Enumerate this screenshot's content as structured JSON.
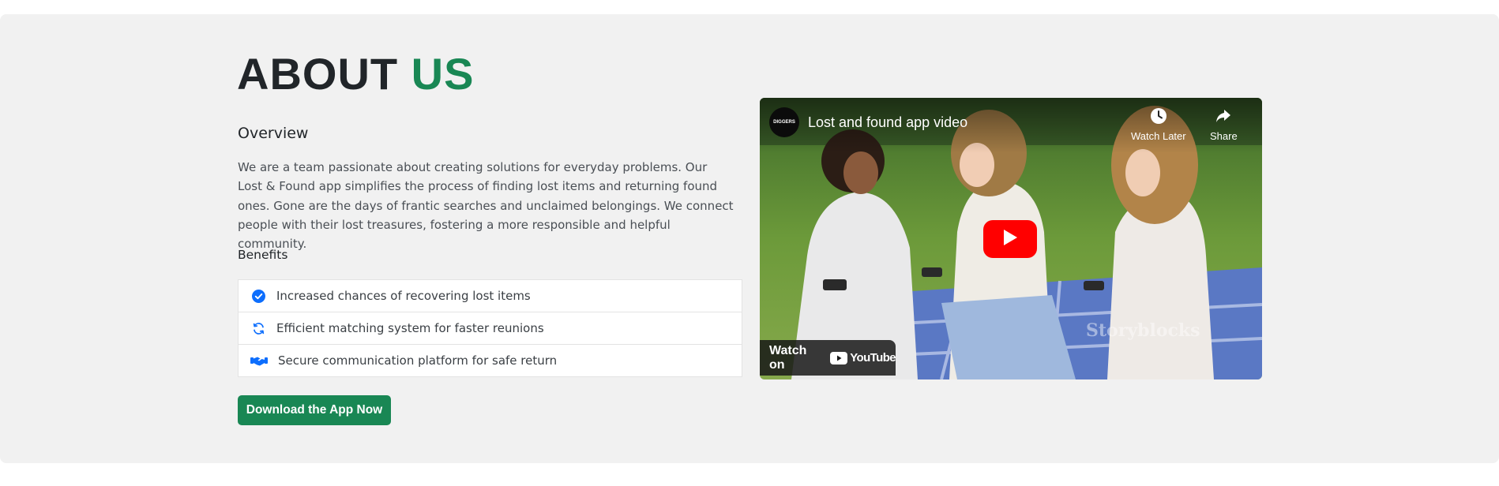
{
  "about": {
    "title_part1": "ABOUT",
    "title_part2": "US",
    "overview_heading": "Overview",
    "overview_text": "We are a team passionate about creating solutions for everyday problems. Our Lost & Found app simplifies the process of finding lost items and returning found ones. Gone are the days of frantic searches and unclaimed belongings. We connect people with their lost treasures, fostering a more responsible and helpful community.",
    "benefits_heading": "Benefits",
    "benefits": [
      {
        "icon": "check-circle-icon",
        "label": "Increased chances of recovering lost items"
      },
      {
        "icon": "sync-icon",
        "label": "Efficient matching system for faster reunions"
      },
      {
        "icon": "handshake-icon",
        "label": "Secure communication platform for safe return"
      }
    ],
    "download_label": "Download the App Now"
  },
  "video": {
    "title": "Lost and found app video",
    "channel_initials": "DIGGERS",
    "watch_later_label": "Watch Later",
    "share_label": "Share",
    "watch_on_label": "Watch on",
    "youtube_label": "YouTube",
    "watermark": "Storyblocks"
  },
  "colors": {
    "accent_green": "#198754",
    "heading_dark": "#212529",
    "icon_blue": "#0d6efd",
    "youtube_red": "#ff0000",
    "section_bg": "#f1f1f1"
  }
}
